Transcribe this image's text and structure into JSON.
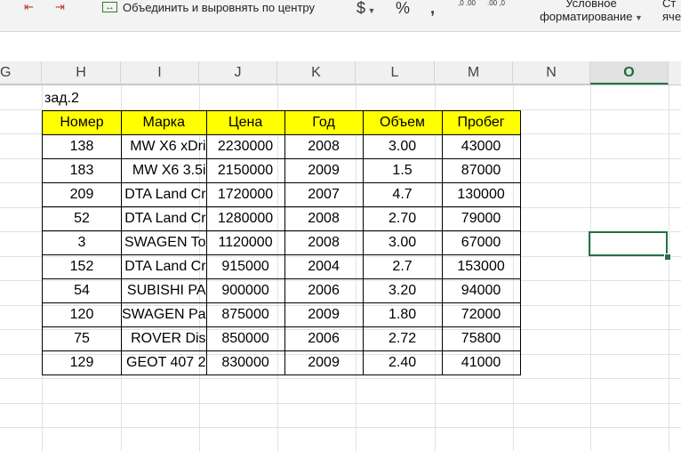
{
  "ribbon": {
    "merge_label": "Объединить и выровнять по центру",
    "currency_symbol": "$",
    "percent_symbol": "%",
    "comma_symbol": ",",
    "increase_decimal": ",0 .00",
    "decrease_decimal": ".00 ,0",
    "conditional_formatting_line1": "Условное",
    "conditional_formatting_line2": "форматирование",
    "cut_off_line1": "Ст",
    "cut_off_line2": "яче"
  },
  "columns": [
    "G",
    "H",
    "I",
    "J",
    "K",
    "L",
    "M",
    "N",
    "O"
  ],
  "selected_column": "O",
  "sheet": {
    "task_label": "зад.2",
    "headers": [
      "Номер",
      "Марка",
      "Цена",
      "Год",
      "Объем",
      "Пробег"
    ],
    "rows": [
      [
        "138",
        "MW X6 xDri",
        "2230000",
        "2008",
        "3.00",
        "43000"
      ],
      [
        "183",
        "MW X6 3.5i",
        "2150000",
        "2009",
        "1.5",
        "87000"
      ],
      [
        "209",
        "DTA Land Cr",
        "1720000",
        "2007",
        "4.7",
        "130000"
      ],
      [
        "52",
        "DTA Land Cr",
        "1280000",
        "2008",
        "2.70",
        "79000"
      ],
      [
        "3",
        "SWAGEN To",
        "1120000",
        "2008",
        "3.00",
        "67000"
      ],
      [
        "152",
        "DTA Land Cr",
        "915000",
        "2004",
        "2.7",
        "153000"
      ],
      [
        "54",
        "SUBISHI PA",
        "900000",
        "2006",
        "3.20",
        "94000"
      ],
      [
        "120",
        "SWAGEN Pa",
        "875000",
        "2009",
        "1.80",
        "72000"
      ],
      [
        "75",
        "ROVER Dis",
        "850000",
        "2006",
        "2.72",
        "75800"
      ],
      [
        "129",
        "GEOT 407 2",
        "830000",
        "2009",
        "2.40",
        "41000"
      ]
    ]
  },
  "colors": {
    "header_fill": "#ffff00",
    "selection": "#217346"
  }
}
